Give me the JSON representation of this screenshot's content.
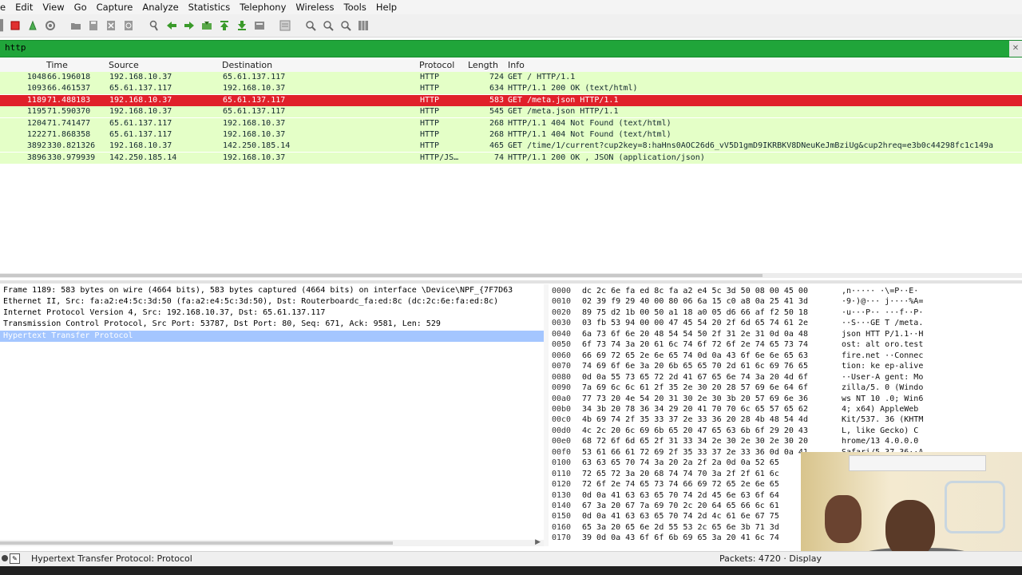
{
  "menu": [
    "e",
    "Edit",
    "View",
    "Go",
    "Capture",
    "Analyze",
    "Statistics",
    "Telephony",
    "Wireless",
    "Tools",
    "Help"
  ],
  "toolbar_icons": [
    "shark-fin-icon",
    "stop-capture-icon",
    "restart-capture-icon",
    "capture-options-icon",
    "open-file-icon",
    "save-file-icon",
    "close-file-icon",
    "reload-icon",
    "find-packet-icon",
    "go-back-icon",
    "go-forward-icon",
    "go-to-packet-icon",
    "go-first-icon",
    "go-last-icon",
    "autoscroll-icon",
    "colorize-icon",
    "zoom-in-icon",
    "zoom-out-icon",
    "normal-size-icon",
    "resize-columns-icon"
  ],
  "filter": {
    "value": "http",
    "color": "#20a53a"
  },
  "columns": {
    "time": "Time",
    "source": "Source",
    "destination": "Destination",
    "protocol": "Protocol",
    "length": "Length",
    "info": "Info"
  },
  "packets": [
    {
      "no": "1048",
      "time": "66.196018",
      "source": "192.168.10.37",
      "destination": "65.61.137.117",
      "protocol": "HTTP",
      "length": "724",
      "info": "GET / HTTP/1.1"
    },
    {
      "no": "1093",
      "time": "66.461537",
      "source": "65.61.137.117",
      "destination": "192.168.10.37",
      "protocol": "HTTP",
      "length": "634",
      "info": "HTTP/1.1 200 OK  (text/html)"
    },
    {
      "no": "1189",
      "time": "71.488183",
      "source": "192.168.10.37",
      "destination": "65.61.137.117",
      "protocol": "HTTP",
      "length": "583",
      "info": "GET /meta.json HTTP/1.1"
    },
    {
      "no": "1195",
      "time": "71.590370",
      "source": "192.168.10.37",
      "destination": "65.61.137.117",
      "protocol": "HTTP",
      "length": "545",
      "info": "GET /meta.json HTTP/1.1"
    },
    {
      "no": "1204",
      "time": "71.741477",
      "source": "65.61.137.117",
      "destination": "192.168.10.37",
      "protocol": "HTTP",
      "length": "268",
      "info": "HTTP/1.1 404 Not Found  (text/html)"
    },
    {
      "no": "1222",
      "time": "71.868358",
      "source": "65.61.137.117",
      "destination": "192.168.10.37",
      "protocol": "HTTP",
      "length": "268",
      "info": "HTTP/1.1 404 Not Found  (text/html)"
    },
    {
      "no": "3892",
      "time": "330.821326",
      "source": "192.168.10.37",
      "destination": "142.250.185.14",
      "protocol": "HTTP",
      "length": "465",
      "info": "GET /time/1/current?cup2key=8:haHns0AOC26d6_vV5D1gmD9IKRBKV8DNeuKeJmBziUg&cup2hreq=e3b0c44298fc1c149a"
    },
    {
      "no": "3896",
      "time": "330.979939",
      "source": "142.250.185.14",
      "destination": "192.168.10.37",
      "protocol": "HTTP/JS…",
      "length": "74",
      "info": "HTTP/1.1 200 OK , JSON (application/json)"
    }
  ],
  "selected_packet": "1189",
  "row_colors": {
    "http": "#e4ffc7",
    "selected": "#e0202a"
  },
  "details": [
    "Frame 1189: 583 bytes on wire (4664 bits), 583 bytes captured (4664 bits) on interface \\Device\\NPF_{7F7D63",
    "Ethernet II, Src: fa:a2:e4:5c:3d:50 (fa:a2:e4:5c:3d:50), Dst: Routerboardc_fa:ed:8c (dc:2c:6e:fa:ed:8c)",
    "Internet Protocol Version 4, Src: 192.168.10.37, Dst: 65.61.137.117",
    "Transmission Control Protocol, Src Port: 53787, Dst Port: 80, Seq: 671, Ack: 9581, Len: 529",
    "Hypertext Transfer Protocol"
  ],
  "hex_rows": [
    {
      "off": "0000",
      "bytes": "dc 2c 6e fa ed 8c fa a2  e4 5c 3d 50 08 00 45 00",
      "ascii": " ,n····· ·\\=P··E·"
    },
    {
      "off": "0010",
      "bytes": "02 39 f9 29 40 00 80 06  6a 15 c0 a8 0a 25 41 3d",
      "ascii": "·9·)@··· j····%A="
    },
    {
      "off": "0020",
      "bytes": "89 75 d2 1b 00 50 a1 18  a0 05 d6 66 af f2 50 18",
      "ascii": "·u···P·· ···f··P·"
    },
    {
      "off": "0030",
      "bytes": "03 fb 53 94 00 00 47 45  54 20 2f 6d 65 74 61 2e",
      "ascii": "··S···GE T /meta."
    },
    {
      "off": "0040",
      "bytes": "6a 73 6f 6e 20 48 54 54  50 2f 31 2e 31 0d 0a 48",
      "ascii": "json HTT P/1.1··H"
    },
    {
      "off": "0050",
      "bytes": "6f 73 74 3a 20 61 6c 74  6f 72 6f 2e 74 65 73 74",
      "ascii": "ost: alt oro.test"
    },
    {
      "off": "0060",
      "bytes": "66 69 72 65 2e 6e 65 74  0d 0a 43 6f 6e 6e 65 63",
      "ascii": "fire.net ··Connec"
    },
    {
      "off": "0070",
      "bytes": "74 69 6f 6e 3a 20 6b 65  65 70 2d 61 6c 69 76 65",
      "ascii": "tion: ke ep-alive"
    },
    {
      "off": "0080",
      "bytes": "0d 0a 55 73 65 72 2d 41  67 65 6e 74 3a 20 4d 6f",
      "ascii": "··User-A gent: Mo"
    },
    {
      "off": "0090",
      "bytes": "7a 69 6c 6c 61 2f 35 2e  30 20 28 57 69 6e 64 6f",
      "ascii": "zilla/5. 0 (Windo"
    },
    {
      "off": "00a0",
      "bytes": "77 73 20 4e 54 20 31 30  2e 30 3b 20 57 69 6e 36",
      "ascii": "ws NT 10 .0; Win6"
    },
    {
      "off": "00b0",
      "bytes": "34 3b 20 78 36 34 29 20  41 70 70 6c 65 57 65 62",
      "ascii": "4; x64)  AppleWeb"
    },
    {
      "off": "00c0",
      "bytes": "4b 69 74 2f 35 33 37 2e  33 36 20 28 4b 48 54 4d",
      "ascii": "Kit/537. 36 (KHTM"
    },
    {
      "off": "00d0",
      "bytes": "4c 2c 20 6c 69 6b 65 20  47 65 63 6b 6f 29 20 43",
      "ascii": "L, like  Gecko) C"
    },
    {
      "off": "00e0",
      "bytes": "68 72 6f 6d 65 2f 31 33  34 2e 30 2e 30 2e 30 20",
      "ascii": "hrome/13 4.0.0.0 "
    },
    {
      "off": "00f0",
      "bytes": "53 61 66 61 72 69 2f 35  33 37 2e 33 36 0d 0a 41",
      "ascii": "Safari/5 37.36··A"
    },
    {
      "off": "0100",
      "bytes": "63 63 65 70 74 3a 20 2a  2f 2a 0d 0a 52 65",
      "ascii": ""
    },
    {
      "off": "0110",
      "bytes": "72 65 72 3a 20 68 74 74  70 3a 2f 2f 61 6c",
      "ascii": ""
    },
    {
      "off": "0120",
      "bytes": "72 6f 2e 74 65 73 74 66  69 72 65 2e 6e 65",
      "ascii": ""
    },
    {
      "off": "0130",
      "bytes": "0d 0a 41 63 63 65 70 74  2d 45 6e 63 6f 64",
      "ascii": ""
    },
    {
      "off": "0140",
      "bytes": "67 3a 20 67 7a 69 70 2c  20 64 65 66 6c 61",
      "ascii": ""
    },
    {
      "off": "0150",
      "bytes": "0d 0a 41 63 63 65 70 74  2d 4c 61 6e 67 75",
      "ascii": ""
    },
    {
      "off": "0160",
      "bytes": "65 3a 20 65 6e 2d 55 53  2c 65 6e 3b 71 3d",
      "ascii": ""
    },
    {
      "off": "0170",
      "bytes": "39 0d 0a 43 6f 6f 6b 69  65 3a 20 41 6c 74",
      "ascii": ""
    }
  ],
  "status": {
    "text": "Hypertext Transfer Protocol: Protocol",
    "right": "Packets: 4720 · Display"
  }
}
